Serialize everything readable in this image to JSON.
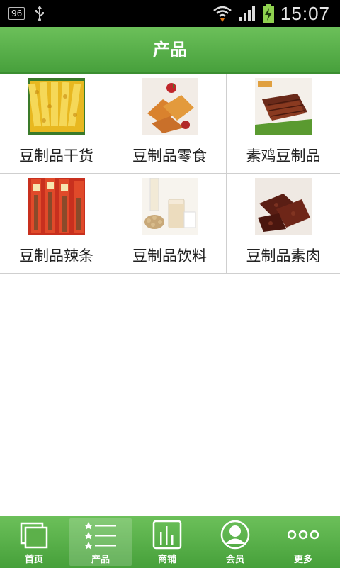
{
  "status_bar": {
    "battery_badge": "96",
    "time": "15:07"
  },
  "header": {
    "title": "产品"
  },
  "products": [
    {
      "label": "豆制品干货",
      "icon": "dried-tofu-image"
    },
    {
      "label": "豆制品零食",
      "icon": "tofu-snack-image"
    },
    {
      "label": "素鸡豆制品",
      "icon": "vegetarian-chicken-image"
    },
    {
      "label": "豆制品辣条",
      "icon": "spicy-strips-image"
    },
    {
      "label": "豆制品饮料",
      "icon": "soy-milk-image"
    },
    {
      "label": "豆制品素肉",
      "icon": "vegetarian-meat-image"
    }
  ],
  "nav": [
    {
      "label": "首页",
      "icon": "home-icon",
      "active": false
    },
    {
      "label": "产品",
      "icon": "list-icon",
      "active": true
    },
    {
      "label": "商铺",
      "icon": "shop-icon",
      "active": false
    },
    {
      "label": "会员",
      "icon": "member-icon",
      "active": false
    },
    {
      "label": "更多",
      "icon": "more-icon",
      "active": false
    }
  ],
  "colors": {
    "header_green": "#5cb04a",
    "nav_green": "#58ad47",
    "status_bar": "#000000"
  }
}
